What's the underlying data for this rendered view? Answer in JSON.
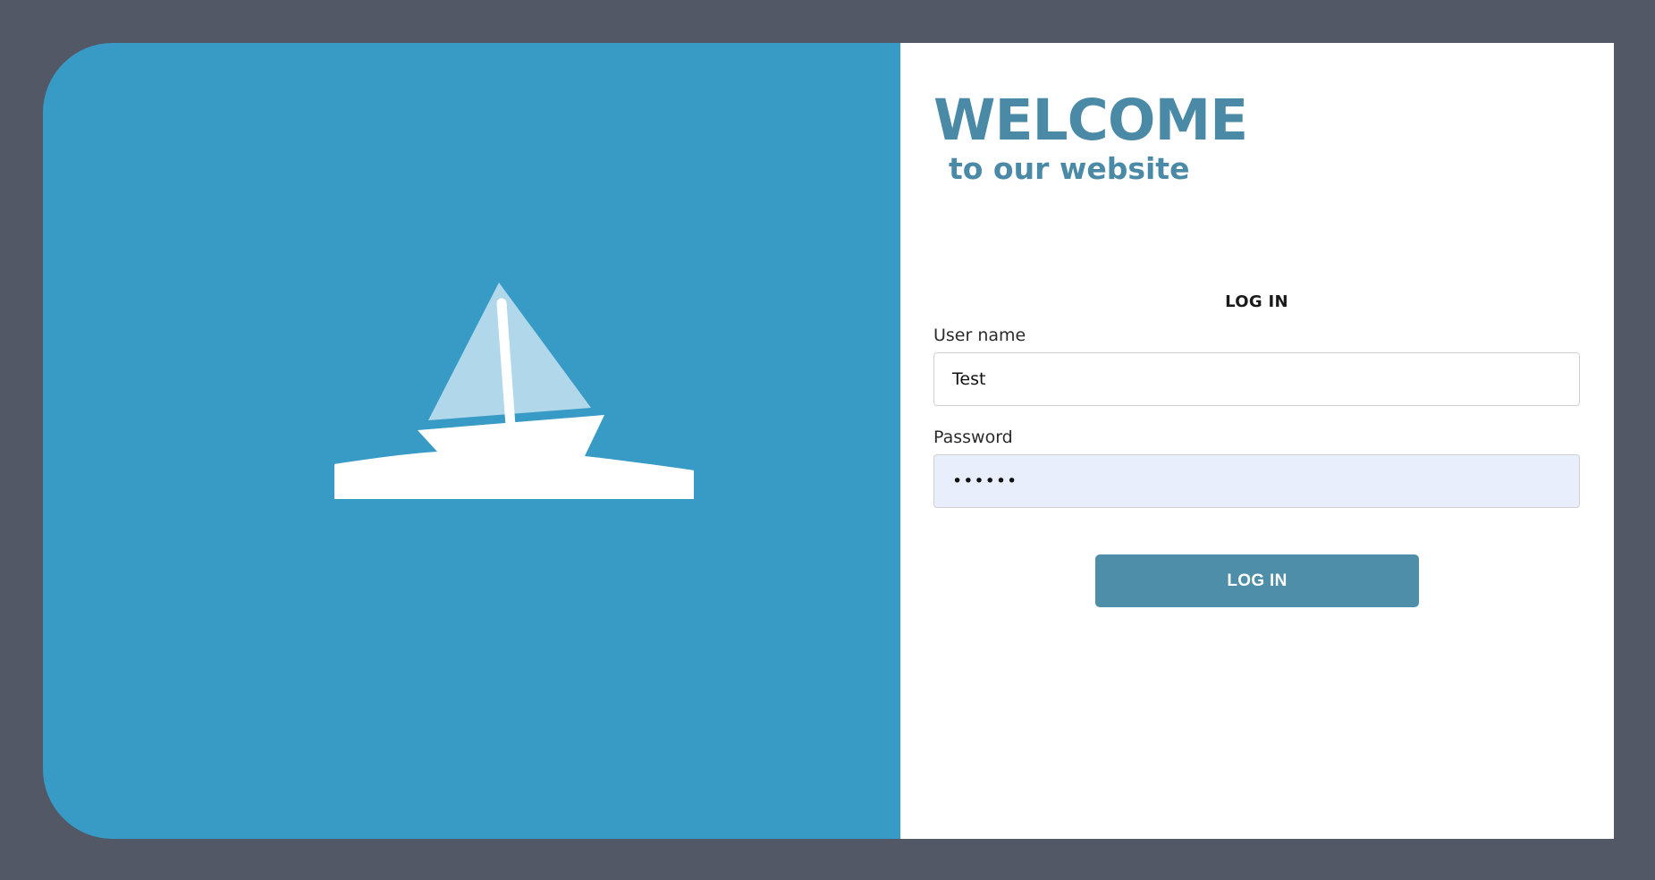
{
  "hero": {
    "illustration": "sailboat-icon",
    "background_color": "#389bc6"
  },
  "header": {
    "title": "WELCOME",
    "subtitle": "to our website",
    "accent_color": "#4a8aa6"
  },
  "login_form": {
    "heading": "LOG IN",
    "username_label": "User name",
    "username_value": "Test",
    "password_label": "Password",
    "password_value": "••••••",
    "submit_label": "LOG IN",
    "button_color": "#4e8ea9"
  }
}
